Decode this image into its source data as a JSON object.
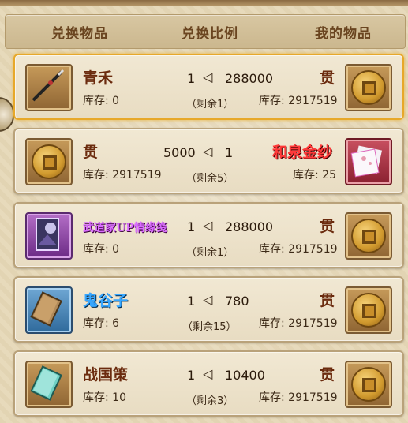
{
  "header": {
    "col_left": "兑换物品",
    "col_mid": "兑换比例",
    "col_right": "我的物品"
  },
  "rows": [
    {
      "left_name": "青禾",
      "left_stock": "库存: 0",
      "ratio_left": "1",
      "ratio_right": "288000",
      "remaining": "（剩余1）",
      "right_name": "贯",
      "right_stock": "库存: 2917519",
      "left_icon": "spear-icon",
      "right_icon": "coin-icon",
      "selected": true
    },
    {
      "left_name": "贯",
      "left_stock": "库存: 2917519",
      "ratio_left": "5000",
      "ratio_right": "1",
      "remaining": "（剩余5）",
      "right_name": "和泉金纱",
      "right_stock": "库存: 25",
      "left_icon": "coin-icon",
      "right_icon": "fabric-icon",
      "selected": false
    },
    {
      "left_name": "武道家UP情缘笺",
      "left_stock": "库存: 0",
      "ratio_left": "1",
      "ratio_right": "288000",
      "remaining": "（剩余1）",
      "right_name": "贯",
      "right_stock": "库存: 2917519",
      "left_icon": "letter-card-icon",
      "right_icon": "coin-icon",
      "selected": false
    },
    {
      "left_name": "鬼谷子",
      "left_stock": "库存: 6",
      "ratio_left": "1",
      "ratio_right": "780",
      "remaining": "（剩余15）",
      "right_name": "贯",
      "right_stock": "库存: 2917519",
      "left_icon": "book-icon",
      "right_icon": "coin-icon",
      "selected": false
    },
    {
      "left_name": "战国策",
      "left_stock": "库存: 10",
      "ratio_left": "1",
      "ratio_right": "10400",
      "remaining": "（剩余3）",
      "right_name": "贯",
      "right_stock": "库存: 2917519",
      "left_icon": "book-icon",
      "right_icon": "coin-icon",
      "selected": false
    }
  ],
  "colors": {
    "header_text": "#6a4520",
    "selected_border": "#e7a82a",
    "purple_name": "#d96bff",
    "blue_name": "#36a6ff",
    "orange_name": "#ff7a1a",
    "red_name": "#ff3a3a"
  }
}
